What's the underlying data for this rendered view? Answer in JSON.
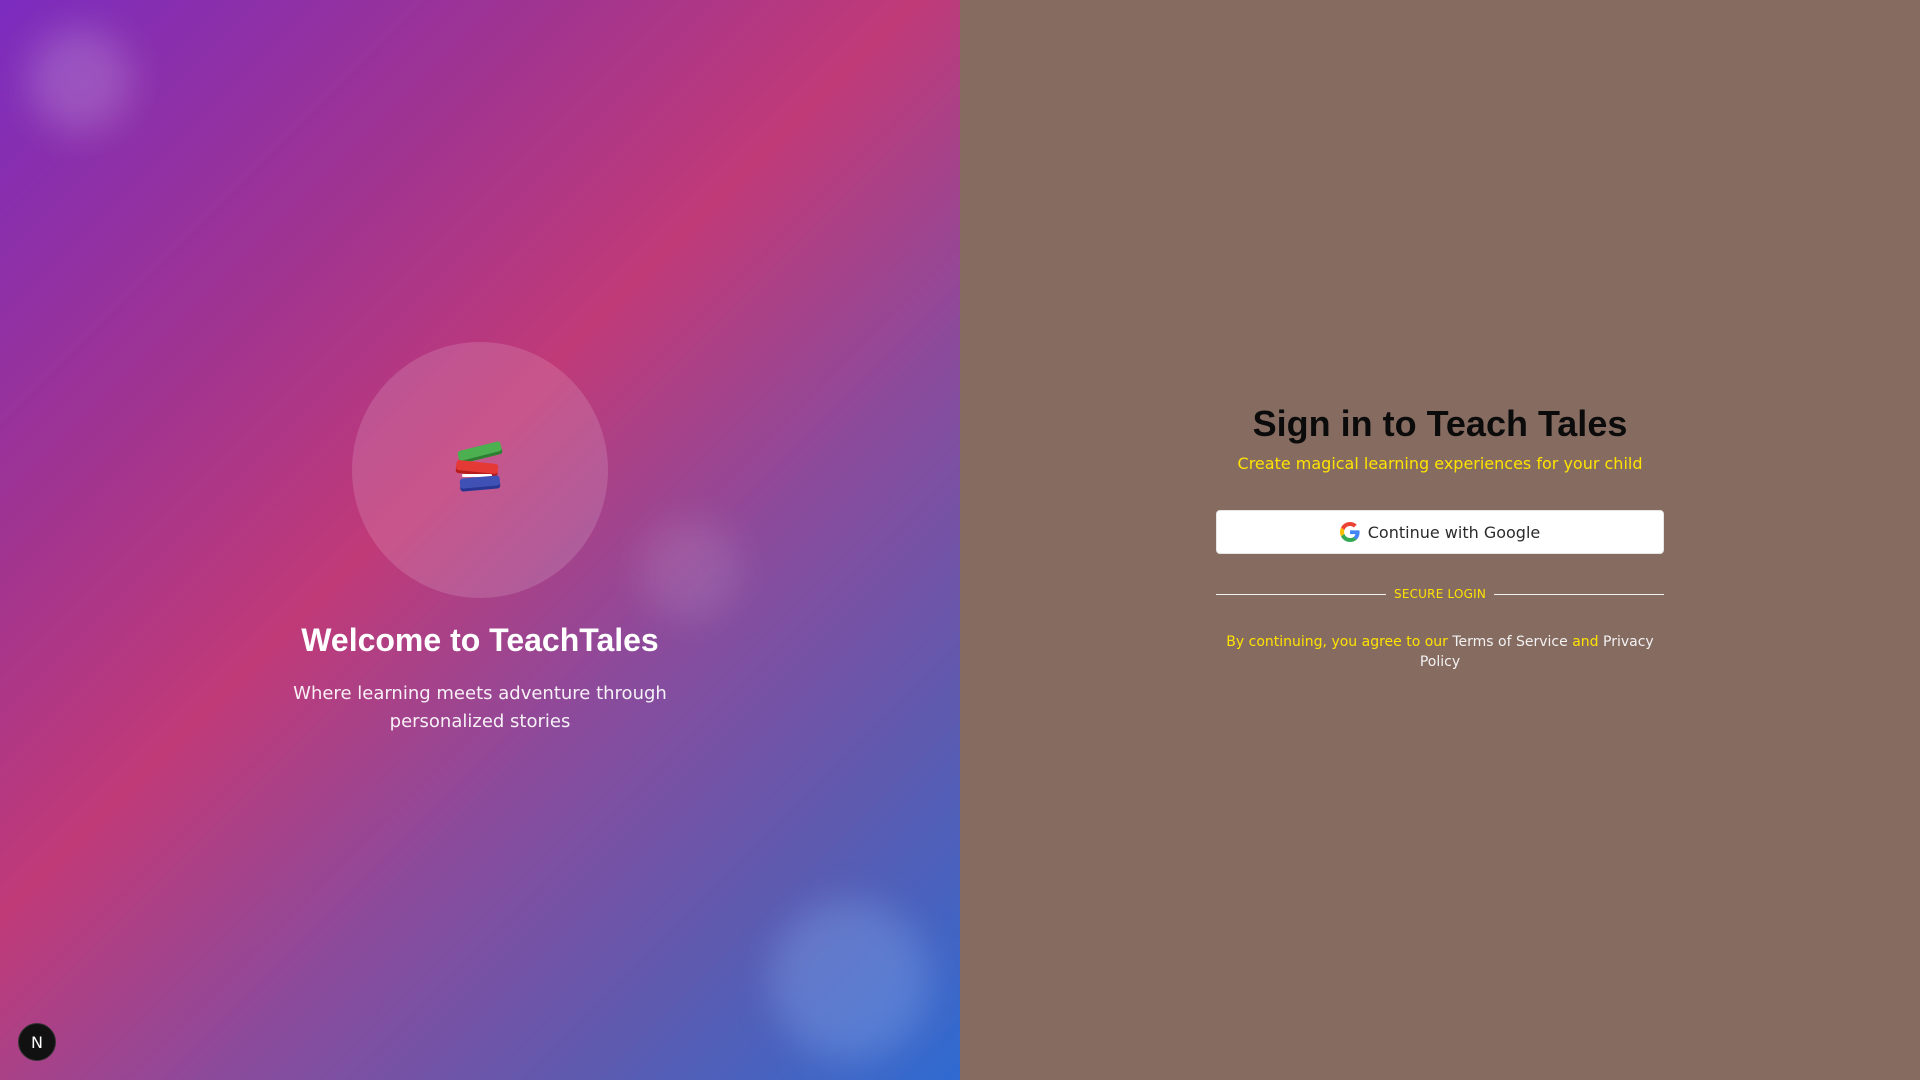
{
  "left_panel": {
    "logo_icon": "books-icon",
    "title": "Welcome to TeachTales",
    "subtitle": "Where learning meets adventure through personalized stories",
    "badge_letter": "N"
  },
  "right_panel": {
    "title": "Sign in to Teach Tales",
    "subtitle": "Create magical learning experiences for your child",
    "google_button": {
      "icon": "google-icon",
      "label": "Continue with Google"
    },
    "divider_text": "SECURE LOGIN",
    "legal": {
      "prefix": "By continuing, you agree to our",
      "terms": "Terms of Service",
      "and": "and",
      "privacy": "Privacy Policy"
    }
  },
  "colors": {
    "right_background": "#866b61",
    "accent_yellow": "#ffe300",
    "title_dark": "#0b0b0b"
  }
}
